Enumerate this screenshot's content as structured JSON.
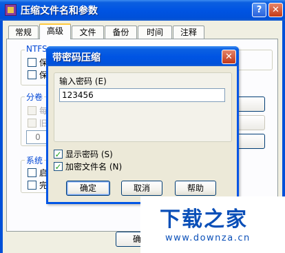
{
  "window": {
    "title": "压缩文件名和参数",
    "help_glyph": "?",
    "close_glyph": "✕"
  },
  "tabs": [
    {
      "label": "常规",
      "active": false
    },
    {
      "label": "高级",
      "active": true
    },
    {
      "label": "文件",
      "active": false
    },
    {
      "label": "备份",
      "active": false
    },
    {
      "label": "时间",
      "active": false
    },
    {
      "label": "注释",
      "active": false
    }
  ],
  "background": {
    "ntfs_group_label": "NTFS",
    "ntfs_items": [
      "保",
      "保"
    ],
    "volume_group_label": "分卷",
    "volume_items": [
      "每",
      "旧"
    ],
    "volume_value": "0",
    "system_group_label": "系统",
    "system_items": [
      "启",
      "完"
    ],
    "ok_partial": "确"
  },
  "dialog": {
    "title": "带密码压缩",
    "password_label": "输入密码 (E)",
    "password_value": "123456",
    "show_password": {
      "label": "显示密码 (S)",
      "checked": true
    },
    "encrypt_names": {
      "label": "加密文件名 (N)",
      "checked": true
    },
    "ok_button": "确定",
    "cancel_button": "取消",
    "help_button": "帮助",
    "close_glyph": "✕",
    "check_glyph": "✓"
  },
  "watermark": {
    "text": "下载之家",
    "url": "www.downza.cn"
  },
  "colors": {
    "titlebar": "#0054e3",
    "window_face": "#ece9d8",
    "close_button": "#c43a17",
    "watermark": "#0a4fb8"
  }
}
